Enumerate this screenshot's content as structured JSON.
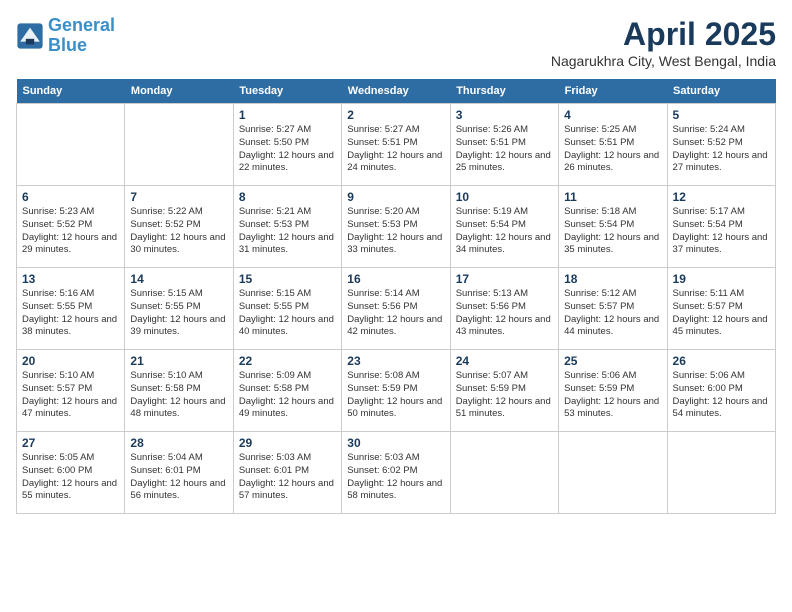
{
  "header": {
    "logo_line1": "General",
    "logo_line2": "Blue",
    "month_title": "April 2025",
    "location": "Nagarukhra City, West Bengal, India"
  },
  "weekdays": [
    "Sunday",
    "Monday",
    "Tuesday",
    "Wednesday",
    "Thursday",
    "Friday",
    "Saturday"
  ],
  "weeks": [
    [
      {
        "day": "",
        "sunrise": "",
        "sunset": "",
        "daylight": ""
      },
      {
        "day": "",
        "sunrise": "",
        "sunset": "",
        "daylight": ""
      },
      {
        "day": "1",
        "sunrise": "Sunrise: 5:27 AM",
        "sunset": "Sunset: 5:50 PM",
        "daylight": "Daylight: 12 hours and 22 minutes."
      },
      {
        "day": "2",
        "sunrise": "Sunrise: 5:27 AM",
        "sunset": "Sunset: 5:51 PM",
        "daylight": "Daylight: 12 hours and 24 minutes."
      },
      {
        "day": "3",
        "sunrise": "Sunrise: 5:26 AM",
        "sunset": "Sunset: 5:51 PM",
        "daylight": "Daylight: 12 hours and 25 minutes."
      },
      {
        "day": "4",
        "sunrise": "Sunrise: 5:25 AM",
        "sunset": "Sunset: 5:51 PM",
        "daylight": "Daylight: 12 hours and 26 minutes."
      },
      {
        "day": "5",
        "sunrise": "Sunrise: 5:24 AM",
        "sunset": "Sunset: 5:52 PM",
        "daylight": "Daylight: 12 hours and 27 minutes."
      }
    ],
    [
      {
        "day": "6",
        "sunrise": "Sunrise: 5:23 AM",
        "sunset": "Sunset: 5:52 PM",
        "daylight": "Daylight: 12 hours and 29 minutes."
      },
      {
        "day": "7",
        "sunrise": "Sunrise: 5:22 AM",
        "sunset": "Sunset: 5:52 PM",
        "daylight": "Daylight: 12 hours and 30 minutes."
      },
      {
        "day": "8",
        "sunrise": "Sunrise: 5:21 AM",
        "sunset": "Sunset: 5:53 PM",
        "daylight": "Daylight: 12 hours and 31 minutes."
      },
      {
        "day": "9",
        "sunrise": "Sunrise: 5:20 AM",
        "sunset": "Sunset: 5:53 PM",
        "daylight": "Daylight: 12 hours and 33 minutes."
      },
      {
        "day": "10",
        "sunrise": "Sunrise: 5:19 AM",
        "sunset": "Sunset: 5:54 PM",
        "daylight": "Daylight: 12 hours and 34 minutes."
      },
      {
        "day": "11",
        "sunrise": "Sunrise: 5:18 AM",
        "sunset": "Sunset: 5:54 PM",
        "daylight": "Daylight: 12 hours and 35 minutes."
      },
      {
        "day": "12",
        "sunrise": "Sunrise: 5:17 AM",
        "sunset": "Sunset: 5:54 PM",
        "daylight": "Daylight: 12 hours and 37 minutes."
      }
    ],
    [
      {
        "day": "13",
        "sunrise": "Sunrise: 5:16 AM",
        "sunset": "Sunset: 5:55 PM",
        "daylight": "Daylight: 12 hours and 38 minutes."
      },
      {
        "day": "14",
        "sunrise": "Sunrise: 5:15 AM",
        "sunset": "Sunset: 5:55 PM",
        "daylight": "Daylight: 12 hours and 39 minutes."
      },
      {
        "day": "15",
        "sunrise": "Sunrise: 5:15 AM",
        "sunset": "Sunset: 5:55 PM",
        "daylight": "Daylight: 12 hours and 40 minutes."
      },
      {
        "day": "16",
        "sunrise": "Sunrise: 5:14 AM",
        "sunset": "Sunset: 5:56 PM",
        "daylight": "Daylight: 12 hours and 42 minutes."
      },
      {
        "day": "17",
        "sunrise": "Sunrise: 5:13 AM",
        "sunset": "Sunset: 5:56 PM",
        "daylight": "Daylight: 12 hours and 43 minutes."
      },
      {
        "day": "18",
        "sunrise": "Sunrise: 5:12 AM",
        "sunset": "Sunset: 5:57 PM",
        "daylight": "Daylight: 12 hours and 44 minutes."
      },
      {
        "day": "19",
        "sunrise": "Sunrise: 5:11 AM",
        "sunset": "Sunset: 5:57 PM",
        "daylight": "Daylight: 12 hours and 45 minutes."
      }
    ],
    [
      {
        "day": "20",
        "sunrise": "Sunrise: 5:10 AM",
        "sunset": "Sunset: 5:57 PM",
        "daylight": "Daylight: 12 hours and 47 minutes."
      },
      {
        "day": "21",
        "sunrise": "Sunrise: 5:10 AM",
        "sunset": "Sunset: 5:58 PM",
        "daylight": "Daylight: 12 hours and 48 minutes."
      },
      {
        "day": "22",
        "sunrise": "Sunrise: 5:09 AM",
        "sunset": "Sunset: 5:58 PM",
        "daylight": "Daylight: 12 hours and 49 minutes."
      },
      {
        "day": "23",
        "sunrise": "Sunrise: 5:08 AM",
        "sunset": "Sunset: 5:59 PM",
        "daylight": "Daylight: 12 hours and 50 minutes."
      },
      {
        "day": "24",
        "sunrise": "Sunrise: 5:07 AM",
        "sunset": "Sunset: 5:59 PM",
        "daylight": "Daylight: 12 hours and 51 minutes."
      },
      {
        "day": "25",
        "sunrise": "Sunrise: 5:06 AM",
        "sunset": "Sunset: 5:59 PM",
        "daylight": "Daylight: 12 hours and 53 minutes."
      },
      {
        "day": "26",
        "sunrise": "Sunrise: 5:06 AM",
        "sunset": "Sunset: 6:00 PM",
        "daylight": "Daylight: 12 hours and 54 minutes."
      }
    ],
    [
      {
        "day": "27",
        "sunrise": "Sunrise: 5:05 AM",
        "sunset": "Sunset: 6:00 PM",
        "daylight": "Daylight: 12 hours and 55 minutes."
      },
      {
        "day": "28",
        "sunrise": "Sunrise: 5:04 AM",
        "sunset": "Sunset: 6:01 PM",
        "daylight": "Daylight: 12 hours and 56 minutes."
      },
      {
        "day": "29",
        "sunrise": "Sunrise: 5:03 AM",
        "sunset": "Sunset: 6:01 PM",
        "daylight": "Daylight: 12 hours and 57 minutes."
      },
      {
        "day": "30",
        "sunrise": "Sunrise: 5:03 AM",
        "sunset": "Sunset: 6:02 PM",
        "daylight": "Daylight: 12 hours and 58 minutes."
      },
      {
        "day": "",
        "sunrise": "",
        "sunset": "",
        "daylight": ""
      },
      {
        "day": "",
        "sunrise": "",
        "sunset": "",
        "daylight": ""
      },
      {
        "day": "",
        "sunrise": "",
        "sunset": "",
        "daylight": ""
      }
    ]
  ]
}
